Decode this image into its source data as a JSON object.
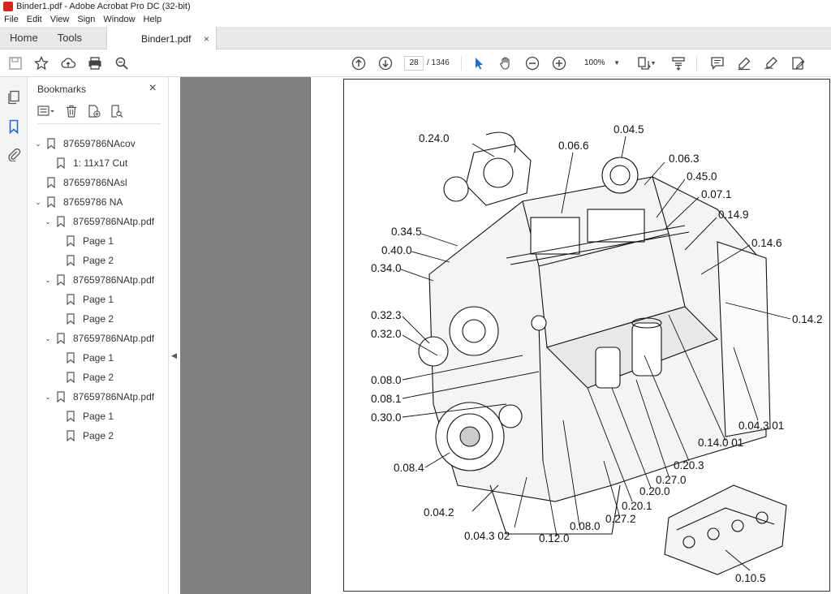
{
  "window": {
    "title": "Binder1.pdf - Adobe Acrobat Pro DC (32-bit)"
  },
  "menu": [
    "File",
    "Edit",
    "View",
    "Sign",
    "Window",
    "Help"
  ],
  "tabs": {
    "home": "Home",
    "tools": "Tools",
    "document": "Binder1.pdf",
    "close": "×"
  },
  "toolbar": {
    "page_current": "28",
    "page_total": "/ 1346",
    "zoom": "100%"
  },
  "bookmarks": {
    "title": "Bookmarks",
    "close": "×",
    "items": [
      {
        "label": "87659786NAcov",
        "twisty": "⌄"
      },
      {
        "label": "1: 11x17 Cut",
        "twisty": ""
      },
      {
        "label": "87659786NAsl",
        "twisty": ""
      },
      {
        "label": "87659786 NA",
        "twisty": "⌄"
      },
      {
        "label": "87659786NAtp.pdf",
        "twisty": "⌄"
      },
      {
        "label": "Page 1",
        "twisty": ""
      },
      {
        "label": "Page 2",
        "twisty": ""
      },
      {
        "label": "87659786NAtp.pdf",
        "twisty": "⌄"
      },
      {
        "label": "Page 1",
        "twisty": ""
      },
      {
        "label": "Page 2",
        "twisty": ""
      },
      {
        "label": "87659786NAtp.pdf",
        "twisty": "⌄"
      },
      {
        "label": "Page 1",
        "twisty": ""
      },
      {
        "label": "Page 2",
        "twisty": ""
      },
      {
        "label": "87659786NAtp.pdf",
        "twisty": "⌄"
      },
      {
        "label": "Page 1",
        "twisty": ""
      },
      {
        "label": "Page 2",
        "twisty": ""
      }
    ]
  },
  "diagram": {
    "labels": [
      "0.24.0",
      "0.06.6",
      "0.04.5",
      "0.06.3",
      "0.45.0",
      "0.07.1",
      "0.14.9",
      "0.14.6",
      "0.34.5",
      "0.40.0",
      "0.34.0",
      "0.32.3",
      "0.32.0",
      "0.14.2",
      "0.08.0",
      "0.08.1",
      "0.30.0",
      "0.04.3 01",
      "0.14.0 01",
      "0.20.3",
      "0.27.0",
      "0.08.4",
      "0.20.0",
      "0.20.1",
      "0.04.2",
      "0.27.2",
      "0.04.3 02",
      "0.08.0",
      "0.12.0",
      "0.10.5"
    ]
  }
}
